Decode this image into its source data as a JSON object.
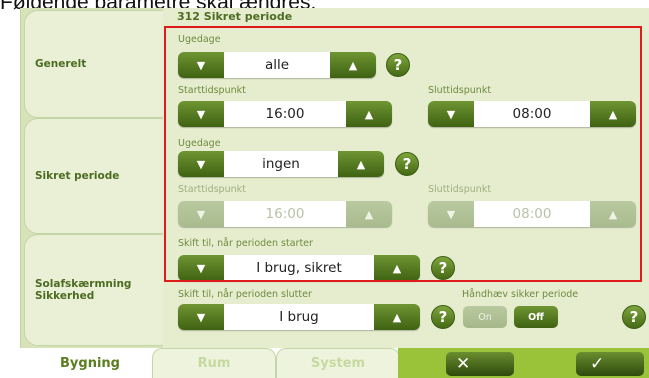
{
  "page_caption_partial": "Følgende parametre skal ændres:",
  "sidebar": {
    "items": [
      {
        "label": "Generelt"
      },
      {
        "label": "Sikret periode"
      },
      {
        "label": "Solafskærmning Sikkerhed"
      }
    ]
  },
  "panel": {
    "title": "312 Sikret periode",
    "weekday1": {
      "label": "Ugedage",
      "value": "alle"
    },
    "start1": {
      "label": "Starttidspunkt",
      "value": "16:00"
    },
    "end1": {
      "label": "Sluttidspunkt",
      "value": "08:00"
    },
    "weekday2": {
      "label": "Ugedage",
      "value": "ingen"
    },
    "start2": {
      "label": "Starttidspunkt",
      "value": "16:00"
    },
    "end2": {
      "label": "Sluttidspunkt",
      "value": "08:00"
    },
    "switch_start": {
      "label": "Skift til, når perioden starter",
      "value": "I brug, sikret"
    },
    "switch_end": {
      "label": "Skift til, når perioden slutter",
      "value": "I brug"
    },
    "enforce": {
      "label": "Håndhæv sikker periode",
      "on": "On",
      "off": "Off",
      "selected": "Off"
    },
    "help_glyph": "?"
  },
  "glyphs": {
    "down": "▼",
    "up": "▲",
    "cancel": "✕",
    "confirm": "✓"
  },
  "tabs": [
    {
      "label": "Bygning",
      "active": true
    },
    {
      "label": "Rum",
      "active": false
    },
    {
      "label": "System",
      "active": false
    }
  ],
  "colors": {
    "accent": "#9bc33a",
    "dark_green": "#3f6212",
    "highlight": "#e01b1b"
  }
}
